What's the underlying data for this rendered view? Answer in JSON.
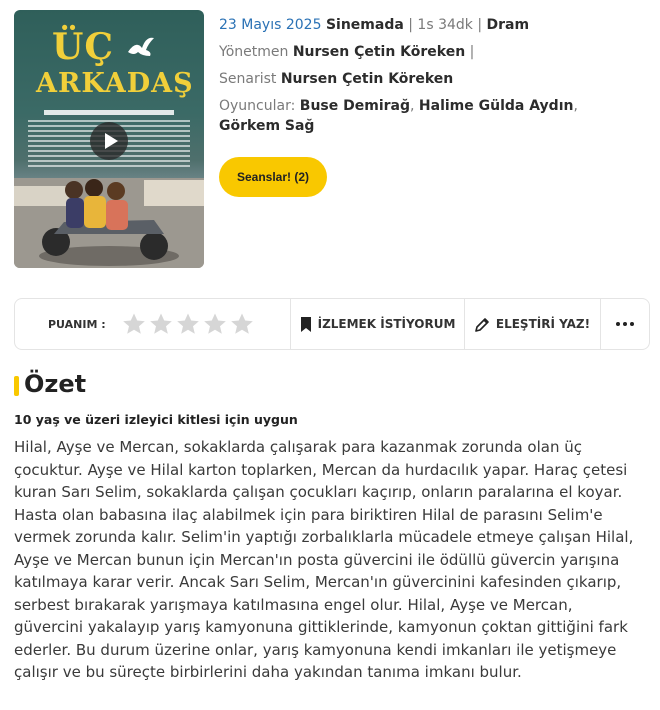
{
  "movie": {
    "poster": {
      "title_line1": "ÜÇ",
      "title_line2": "ARKADAŞ",
      "icons": [
        "dove-icon",
        "play-icon"
      ]
    },
    "date": "23 Mayıs 2025",
    "venue": "Sinemada",
    "duration": "1s 34dk",
    "genre": "Dram",
    "sep": "|",
    "director_label": "Yönetmen",
    "director": "Nursen Çetin Köreken",
    "writer_label": "Senarist",
    "writer": "Nursen Çetin Köreken",
    "cast_label": "Oyuncular:",
    "cast": [
      "Buse Demirağ",
      "Halime Gülda Aydın",
      "Görkem Sağ"
    ],
    "sessions_button": "Seanslar! (2)"
  },
  "actions": {
    "rating_label": "PUANIM :",
    "rating_value": 0,
    "rating_max": 5,
    "star_empty_color": "#d6d6d6",
    "watchlist_label": "İZLEMEK İSTİYORUM",
    "review_label": "ELEŞTİRİ YAZ!",
    "more_icon": "more-dots-icon"
  },
  "summary": {
    "title": "Özet",
    "accent_color": "#f9c800",
    "age_rating": "10 yaş ve üzeri izleyici kitlesi için uygun",
    "text": "Hilal, Ayşe ve Mercan, sokaklarda çalışarak para kazanmak zorunda olan üç çocuktur. Ayşe ve Hilal karton toplarken, Mercan da hurdacılık yapar. Haraç çetesi kuran Sarı Selim, sokaklarda çalışan çocukları kaçırıp, onların paralarına el koyar. Hasta olan babasına ilaç alabilmek için para biriktiren Hilal de parasını Selim'e vermek zorunda kalır. Selim'in yaptığı zorbalıklarla mücadele etmeye çalışan Hilal, Ayşe ve Mercan bunun için Mercan'ın posta güvercini ile ödüllü güvercin yarışına katılmaya karar verir. Ancak Sarı Selim, Mercan'ın güvercinini kafesinden çıkarıp, serbest bırakarak yarışmaya katılmasına engel olur. Hilal, Ayşe ve Mercan, güvercini yakalayıp yarış kamyonuna gittiklerinde, kamyonun çoktan gittiğini fark ederler. Bu durum üzerine onlar, yarış kamyonuna kendi imkanları ile yetişmeye çalışır ve bu süreçte birbirlerini daha yakından tanıma imkanı bulur."
  }
}
